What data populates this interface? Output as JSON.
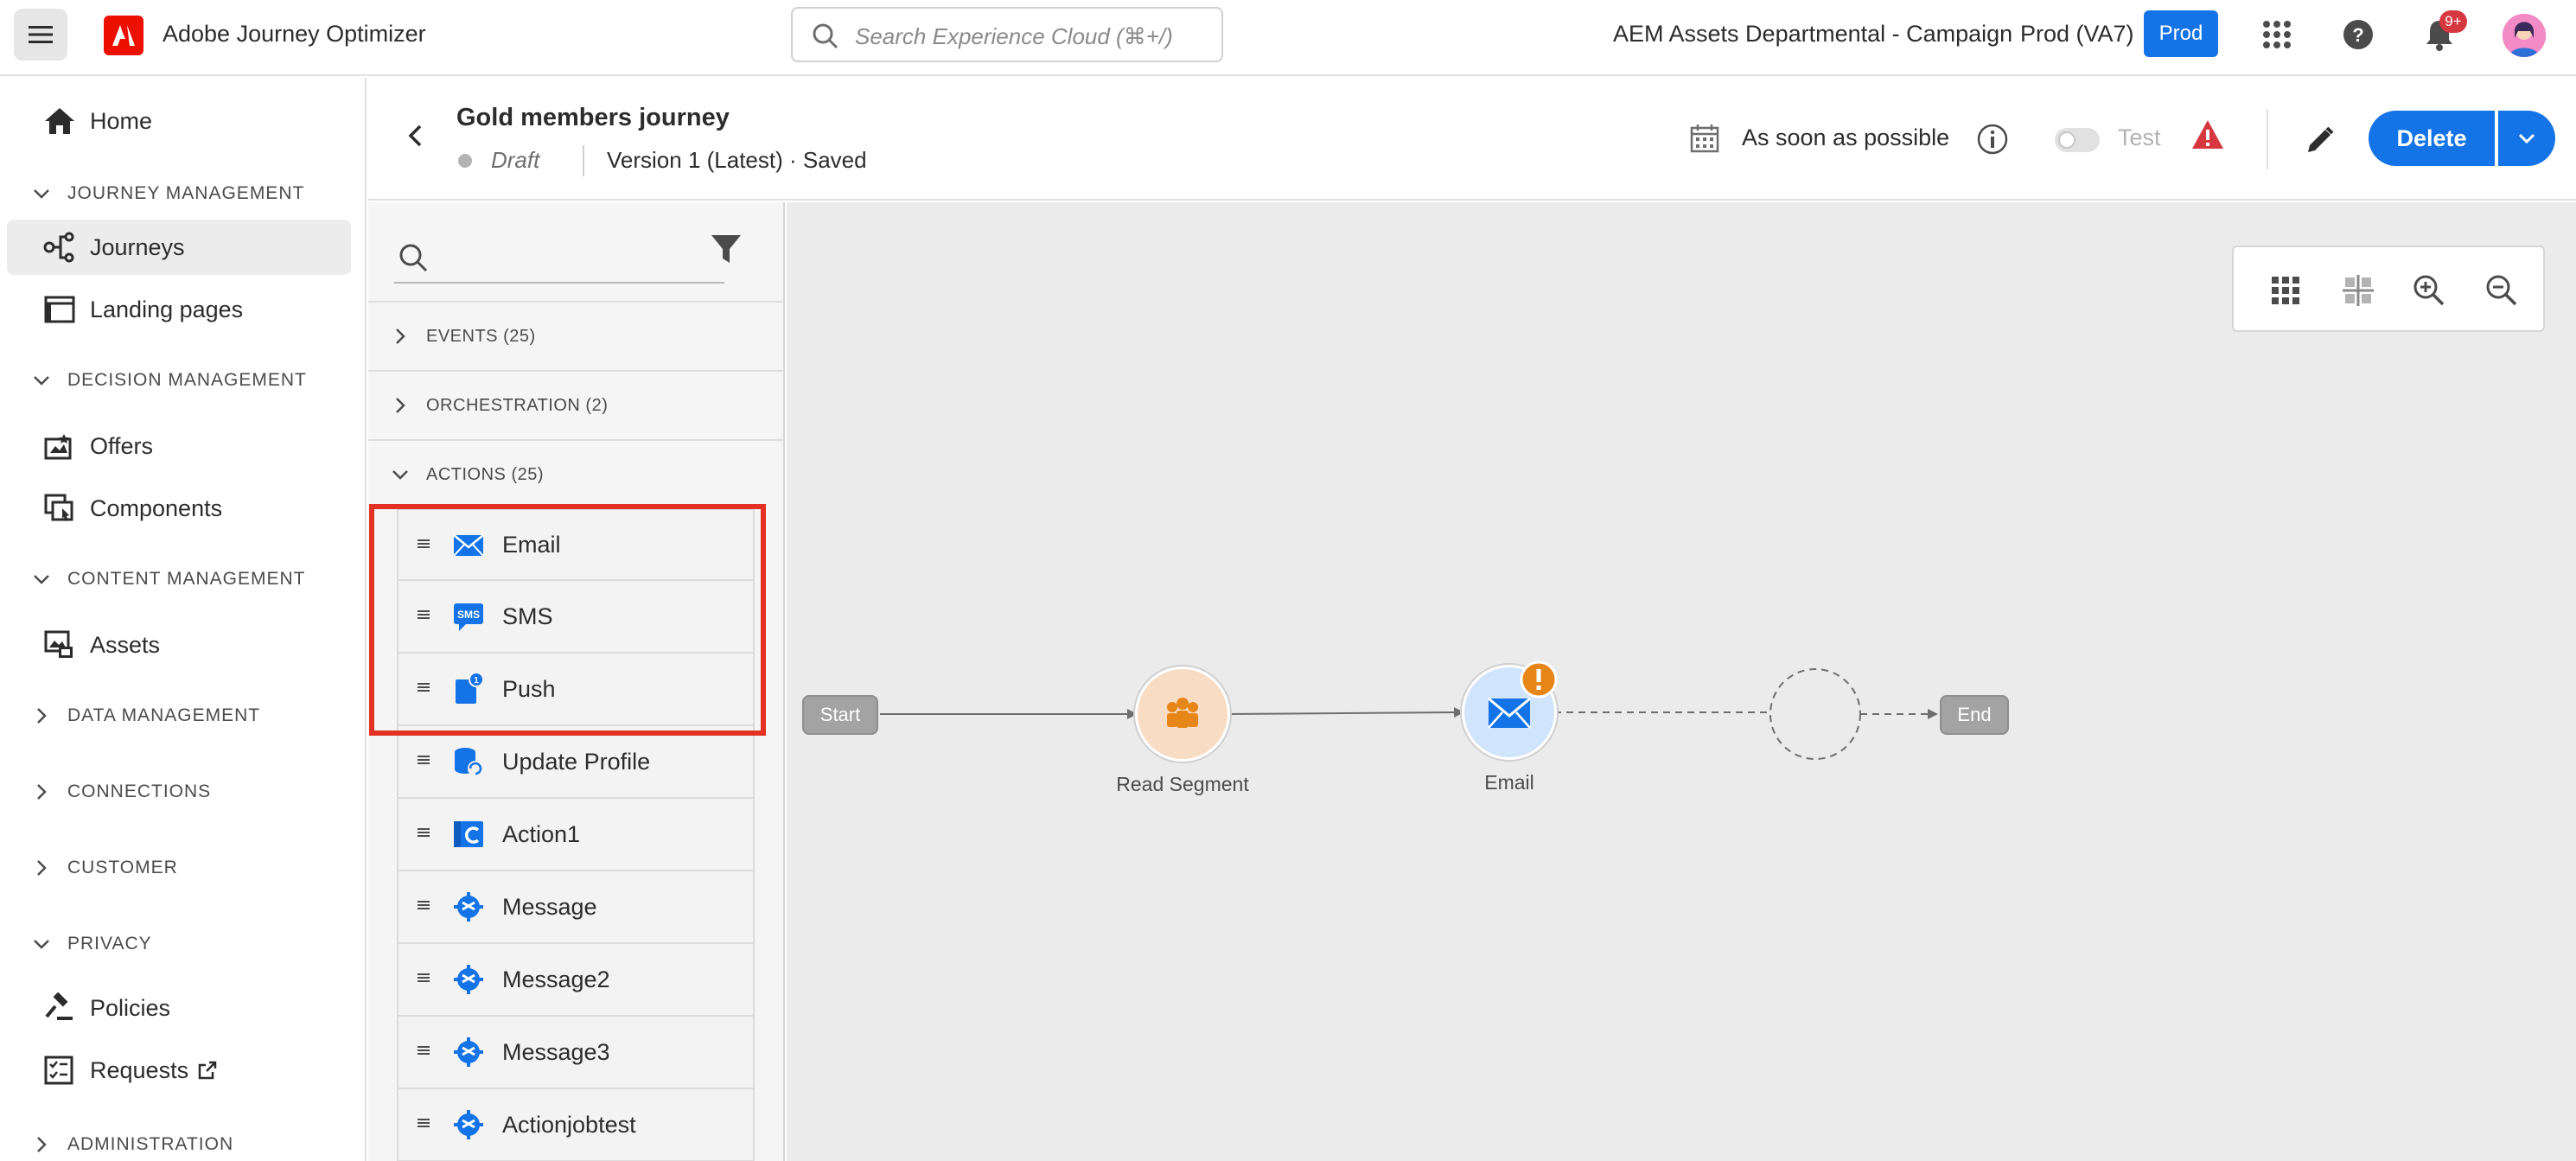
{
  "topbar": {
    "app_title": "Adobe Journey Optimizer",
    "search_placeholder": "Search Experience Cloud (⌘+/)",
    "org_name": "AEM Assets Departmental - Campaign",
    "env_name": "Prod (VA7)",
    "env_badge": "Prod",
    "notification_count": "9+"
  },
  "leftnav": {
    "home": "Home",
    "sections": {
      "journey_management": "JOURNEY MANAGEMENT",
      "decision_management": "DECISION MANAGEMENT",
      "content_management": "CONTENT MANAGEMENT",
      "data_management": "DATA MANAGEMENT",
      "connections": "CONNECTIONS",
      "customer": "CUSTOMER",
      "privacy": "PRIVACY",
      "administration": "ADMINISTRATION"
    },
    "items": {
      "journeys": "Journeys",
      "landing_pages": "Landing pages",
      "offers": "Offers",
      "components": "Components",
      "assets": "Assets",
      "policies": "Policies",
      "requests": "Requests"
    }
  },
  "journey": {
    "title": "Gold members journey",
    "status": "Draft",
    "version": "Version 1 (Latest) · Saved",
    "schedule": "As soon as possible",
    "test_label": "Test",
    "delete_label": "Delete"
  },
  "palette": {
    "categories": {
      "events": "EVENTS (25)",
      "orchestration": "ORCHESTRATION (2)",
      "actions": "ACTIONS (25)"
    },
    "actions": [
      "Email",
      "SMS",
      "Push",
      "Update Profile",
      "Action1",
      "Message",
      "Message2",
      "Message3",
      "Actionjobtest"
    ]
  },
  "canvas": {
    "start_label": "Start",
    "read_segment_label": "Read Segment",
    "email_label": "Email",
    "end_label": "End"
  },
  "colors": {
    "accent": "#1473e6",
    "alert": "#d7373f",
    "highlight": "#e33223",
    "warning_badge": "#e68619"
  }
}
